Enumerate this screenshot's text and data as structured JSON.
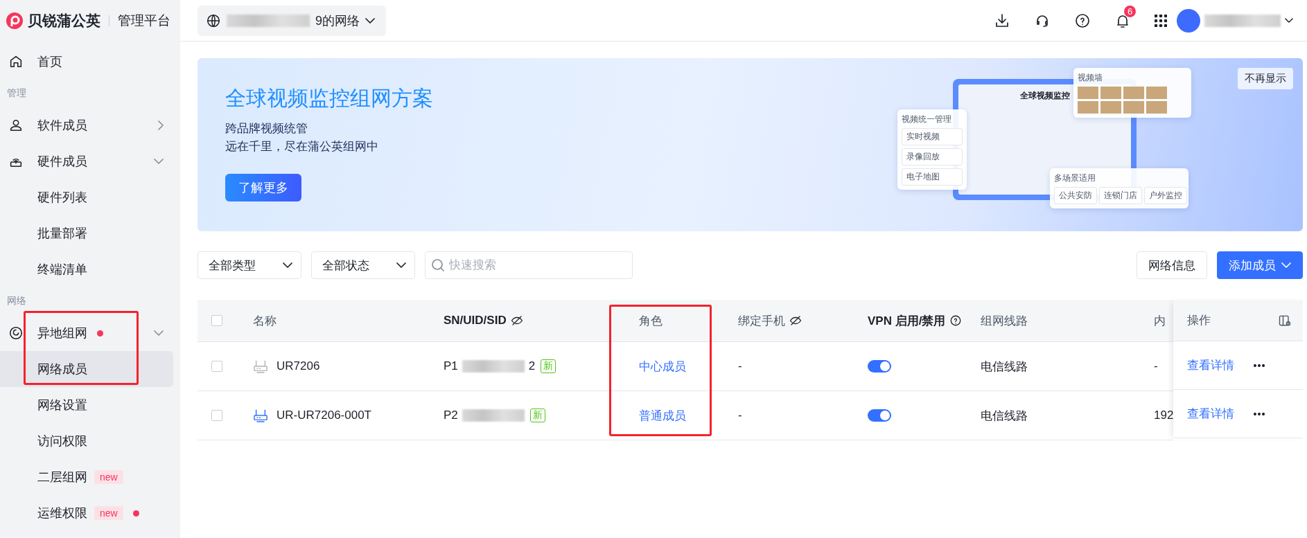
{
  "brand": {
    "name": "贝锐蒲公英",
    "product": "管理平台"
  },
  "network_selector": {
    "label": "9的网络"
  },
  "topbar": {
    "notification_count": "6"
  },
  "sidebar": {
    "items": [
      {
        "kind": "item",
        "label": "首页",
        "selected": false
      },
      {
        "kind": "group",
        "label": "管理"
      },
      {
        "kind": "item",
        "label": "软件成员",
        "expanded": false,
        "selected": false
      },
      {
        "kind": "item",
        "label": "硬件成员",
        "expanded": true,
        "selected": false
      },
      {
        "kind": "sub",
        "label": "硬件列表",
        "selected": false
      },
      {
        "kind": "sub",
        "label": "批量部署",
        "selected": false
      },
      {
        "kind": "sub",
        "label": "终端清单",
        "selected": false
      },
      {
        "kind": "group",
        "label": "网络"
      },
      {
        "kind": "item",
        "label": "异地组网",
        "expanded": true,
        "dot": true,
        "selected": false,
        "highlighted": true
      },
      {
        "kind": "sub",
        "label": "网络成员",
        "selected": true,
        "highlighted": true
      },
      {
        "kind": "sub",
        "label": "网络设置",
        "selected": false
      },
      {
        "kind": "sub",
        "label": "访问权限",
        "selected": false
      },
      {
        "kind": "sub",
        "label": "二层组网",
        "tag": "new",
        "selected": false
      },
      {
        "kind": "sub",
        "label": "运维权限",
        "tag": "new",
        "dot": true,
        "selected": false
      }
    ]
  },
  "banner": {
    "title": "全球视频监控组网方案",
    "lines": [
      "跨品牌视频统管",
      "远在千里，尽在蒲公英组网中"
    ],
    "button": "了解更多",
    "dismiss": "不再显示",
    "illustration": {
      "screen_title": "全球视频监控",
      "panel_title": "视频统一管理",
      "panel_items": [
        "实时视频",
        "录像回放",
        "电子地图"
      ],
      "wall_title": "视频墙",
      "scene_title": "多场景适用",
      "scenes": [
        "公共安防",
        "连锁门店",
        "户外监控"
      ]
    }
  },
  "toolbar": {
    "filters": [
      "全部类型",
      "全部状态"
    ],
    "search": {
      "placeholder": "快速搜索"
    },
    "info_button": "网络信息",
    "add_button": "添加成员"
  },
  "table": {
    "columns": [
      {
        "label": "名称"
      },
      {
        "label": "SN/UID/SID"
      },
      {
        "label": "角色",
        "highlighted": true
      },
      {
        "label": "绑定手机"
      },
      {
        "label": "VPN 启用/禁用"
      },
      {
        "label": "组网线路"
      },
      {
        "label": "内"
      }
    ],
    "select_all_checked": false,
    "actions_column": "操作",
    "rows": [
      {
        "name": "UR7206",
        "online": false,
        "sn_start": "P1",
        "sn_end": "2",
        "badge": "新",
        "role": "中心成员",
        "phone": "-",
        "vpn_enabled": true,
        "route": "电信线路",
        "ip": "-",
        "action": "查看详情",
        "checked": false
      },
      {
        "name": "UR-UR7206-000T",
        "online": true,
        "sn_start": "P2",
        "sn_end": "",
        "badge": "新",
        "role": "普通成员",
        "phone": "-",
        "vpn_enabled": true,
        "route": "电信线路",
        "ip": "192",
        "action": "查看详情",
        "checked": false
      }
    ]
  }
}
